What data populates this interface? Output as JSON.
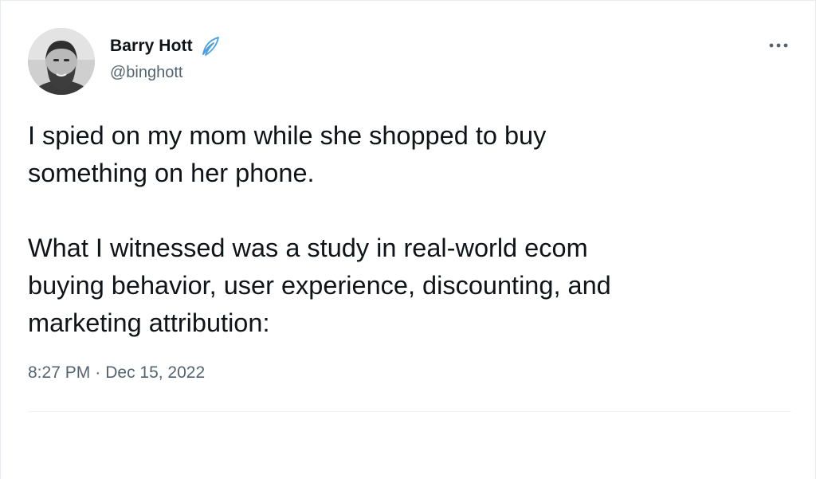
{
  "author": {
    "display_name": "Barry Hott",
    "handle": "@binghott",
    "badge_icon": "feather-icon"
  },
  "tweet": {
    "paragraphs": [
      [
        "I spied on my mom while she shopped to buy",
        "something on her phone."
      ],
      [
        "What I witnessed was a study in real-world ecom",
        "buying behavior, user experience, discounting, and",
        "marketing attribution:"
      ]
    ],
    "time": "8:27 PM",
    "separator": "·",
    "date": "Dec 15, 2022"
  },
  "icons": {
    "more": "more-options-icon"
  },
  "colors": {
    "text": "#0f1419",
    "secondary": "#536471",
    "divider": "#eff3f4",
    "feather": "#4a9fe0"
  }
}
